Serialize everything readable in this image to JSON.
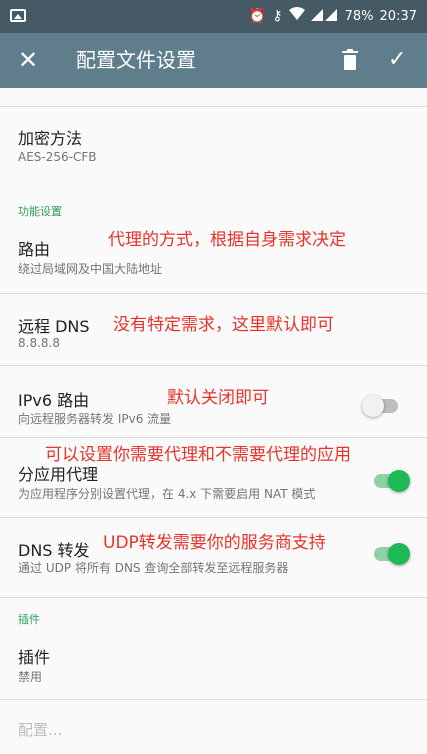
{
  "status_bar": {
    "battery": "78%",
    "time": "20:37",
    "icons": [
      "image-icon",
      "alarm-icon",
      "key-icon",
      "wifi-icon",
      "signal-icon"
    ]
  },
  "toolbar": {
    "title": "配置文件设置",
    "close_icon": "close-icon",
    "delete_icon": "trash-icon",
    "save_icon": "check-icon"
  },
  "prefs": {
    "encryption": {
      "title": "加密方法",
      "summary": "AES-256-CFB"
    },
    "feature_category": "功能设置",
    "route": {
      "title": "路由",
      "summary": "绕过局域网及中国大陆地址"
    },
    "remote_dns": {
      "title": "远程 DNS",
      "summary": "8.8.8.8"
    },
    "ipv6": {
      "title": "IPv6 路由",
      "summary": "向远程服务器转发 IPv6 流量",
      "enabled": false
    },
    "per_app": {
      "title": "分应用代理",
      "summary": "为应用程序分别设置代理，在 4.x 下需要启用 NAT 模式",
      "enabled": true
    },
    "dns_forward": {
      "title": "DNS 转发",
      "summary": "通过 UDP 将所有 DNS 查询全部转发至远程服务器",
      "enabled": true
    },
    "plugin_category": "插件",
    "plugin": {
      "title": "插件",
      "summary": "禁用"
    },
    "config_label": "配置..."
  },
  "annotations": {
    "route_note": "代理的方式，根据自身需求决定",
    "dns_note": "没有特定需求，这里默认即可",
    "ipv6_note": "默认关闭即可",
    "per_app_note": "可以设置你需要代理和不需要代理的应用",
    "dns_forward_note": "UDP转发需要你的服务商支持"
  },
  "colors": {
    "status_bar": "#455a64",
    "toolbar": "#607d8b",
    "accent": "#1db954",
    "annotation": "#e8332b"
  }
}
